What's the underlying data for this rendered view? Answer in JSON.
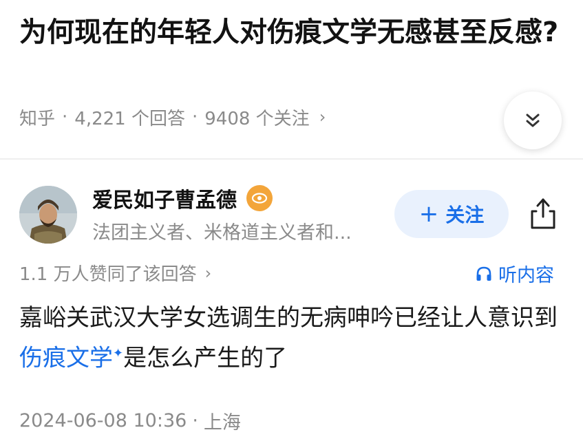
{
  "question": {
    "title": "为何现在的年轻人对伤痕文学无感甚至反感?",
    "source": "知乎",
    "answers": "4,221 个回答",
    "followers": "9408 个关注",
    "sep": "·",
    "chevron": "›",
    "expand_icon": "double-chevron-down-icon"
  },
  "author": {
    "name": "爱民如子曹孟德",
    "bio": "法团主义者、米格道主义者和...",
    "badge_icon": "eye-badge-icon"
  },
  "actions": {
    "follow_plus": "+",
    "follow_label": "关注",
    "share_icon": "share-icon"
  },
  "answer_meta": {
    "votes": "1.1 万人赞同了该回答",
    "chevron": "›",
    "listen_label": "听内容"
  },
  "answer": {
    "text_before": "嘉峪关武汉大学女选调生的无病呻吟已经让人意识到",
    "link": "伤痕文学",
    "spark": "✦",
    "text_after": "是怎么产生的了"
  },
  "footer": {
    "datetime": "2024-06-08 10:36",
    "sep": "·",
    "location": "上海"
  },
  "colors": {
    "accent": "#1a6fe8",
    "muted": "#8a8a8a",
    "follow_bg": "#e9f1fd",
    "badge": "#f3a53a"
  }
}
